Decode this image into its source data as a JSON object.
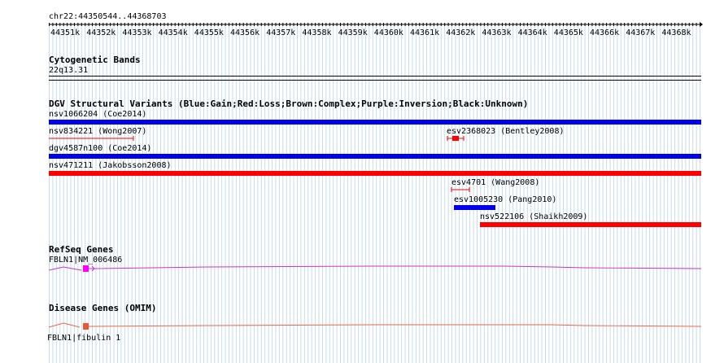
{
  "location": "chr22:44350544..44368703",
  "ruler": {
    "labels": [
      "44351k",
      "44352k",
      "44353k",
      "44354k",
      "44355k",
      "44356k",
      "44357k",
      "44358k",
      "44359k",
      "44360k",
      "44361k",
      "44362k",
      "44363k",
      "44364k",
      "44365k",
      "44366k",
      "44367k",
      "44368k"
    ]
  },
  "tracks": {
    "cytoband": {
      "title": "Cytogenetic Bands",
      "band": "22q13.31"
    },
    "dgv": {
      "title": "DGV Structural Variants (Blue:Gain;Red:Loss;Brown:Complex;Purple:Inversion;Black:Unknown)",
      "colors": {
        "gain": "#0000ee",
        "loss": "#ff0000"
      },
      "variants": [
        {
          "label": "nsv1066204 (Coe2014)",
          "type": "gain"
        },
        {
          "label": "nsv834221 (Wong2007)",
          "type": "loss"
        },
        {
          "label": "esv2368023 (Bentley2008)",
          "type": "loss"
        },
        {
          "label": "dgv4587n100 (Coe2014)",
          "type": "gain"
        },
        {
          "label": "nsv471211 (Jakobsson2008)",
          "type": "loss"
        },
        {
          "label": "esv4701 (Wang2008)",
          "type": "loss"
        },
        {
          "label": "esv1005230 (Pang2010)",
          "type": "gain"
        },
        {
          "label": "nsv522106 (Shaikh2009)",
          "type": "loss"
        }
      ]
    },
    "refseq": {
      "title": "RefSeq Genes",
      "gene": "FBLN1|NM_006486",
      "color": "#cc33cc"
    },
    "omim": {
      "title": "Disease Genes (OMIM)",
      "gene": "FBLN1|fibulin 1",
      "color": "#ee6644"
    }
  }
}
